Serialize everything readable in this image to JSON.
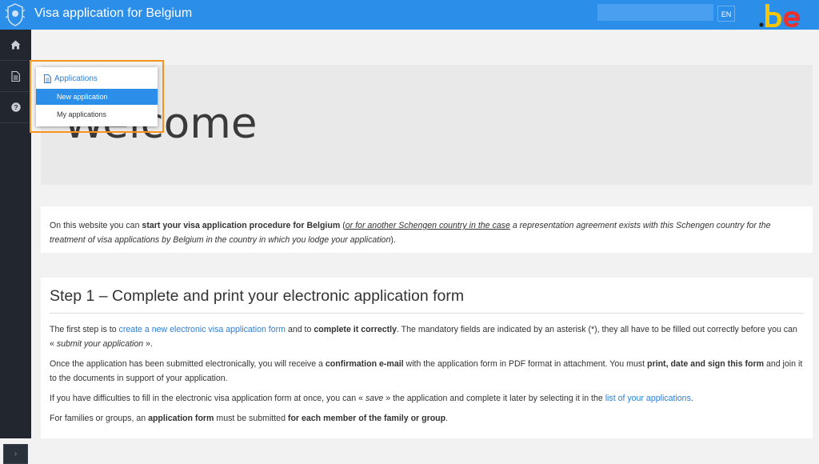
{
  "header": {
    "title": "Visa application for Belgium",
    "search_placeholder": "",
    "language": "EN",
    "brand_logo_text": ".be",
    "colors": {
      "bar": "#2b8ee8",
      "be_yellow": "#f7c600",
      "be_red": "#e8312f",
      "be_dark": "#222222"
    }
  },
  "sidebar": {
    "items": [
      {
        "icon": "home-icon"
      },
      {
        "icon": "document-icon"
      },
      {
        "icon": "help-icon"
      }
    ],
    "toggle_label": "›"
  },
  "dropdown": {
    "header": "Applications",
    "items": [
      {
        "label": "New application",
        "active": true
      },
      {
        "label": "My applications",
        "active": false
      }
    ]
  },
  "hero": {
    "title": "Welcome"
  },
  "intro": {
    "t1": "On this website you can ",
    "b1": "start your visa application procedure for Belgium",
    "t2": " (",
    "i1": "or for another Schengen country in the case",
    "i2": " a representation agreement exists with this Schengen country for the treatment of visa applications by Belgium in the country in which you lodge your application",
    "t3": ")."
  },
  "step1": {
    "title": "Step 1 – Complete and print your electronic application form",
    "p1": {
      "t1": "The first step is to ",
      "link": "create a new electronic visa application form",
      "t2": " and to ",
      "b1": "complete it correctly",
      "t3": ". The mandatory fields are indicated by an asterisk (*), they all have to be filled out correctly before you can « ",
      "i1": "submit your application",
      "t4": " »."
    },
    "p2": {
      "t1": "Once the application has been submitted electronically, you will receive a ",
      "b1": "confirmation e-mail",
      "t2": " with the application form in PDF format in attachment. You must ",
      "b2": "print, date and sign this form",
      "t3": " and join it to the documents in support of your application."
    },
    "p3": {
      "t1": "If you have difficulties to fill in the electronic visa application form at once, you can « ",
      "i1": "save",
      "t2": " » the application and complete it later by selecting it in the ",
      "link": "list of your applications",
      "t3": "."
    },
    "p4": {
      "t1": "For families or groups, an ",
      "b1": "application form",
      "t2": " must be submitted ",
      "b2": "for each member of the family or group",
      "t3": "."
    }
  }
}
